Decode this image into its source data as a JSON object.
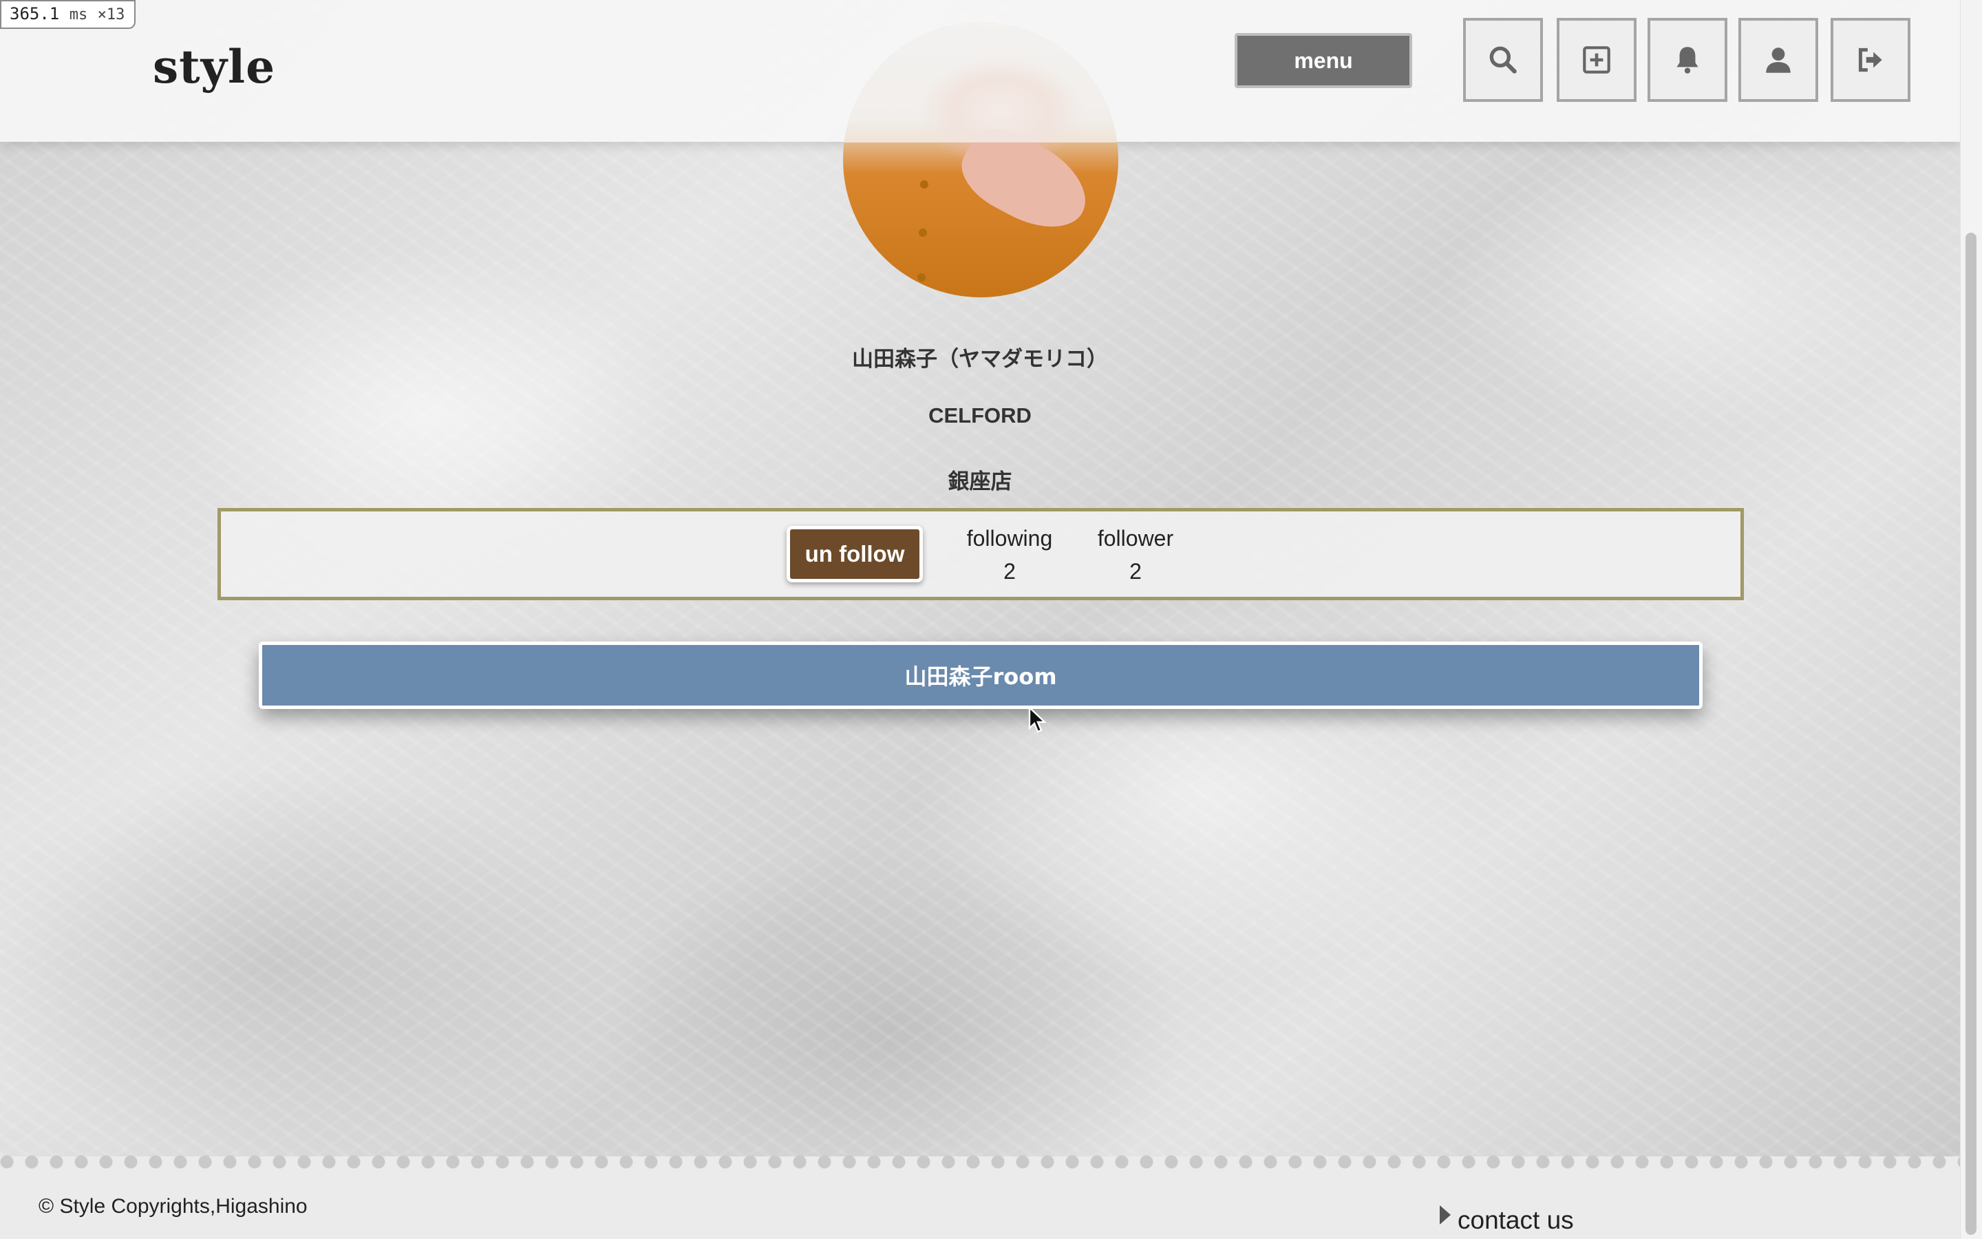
{
  "perf_badge": {
    "value": "365.1",
    "unit": "ms",
    "multiplier": "×13"
  },
  "header": {
    "logo": "style",
    "menu_label": "menu",
    "icons": [
      "search-icon",
      "add-post-icon",
      "bell-icon",
      "user-icon",
      "logout-icon"
    ]
  },
  "profile": {
    "name": "山田森子（ヤマダモリコ）",
    "brand": "CELFORD",
    "store": "銀座店"
  },
  "follow": {
    "button_label": "un follow",
    "following_label": "following",
    "following_count": "2",
    "follower_label": "follower",
    "follower_count": "2"
  },
  "room": {
    "button_label": "山田森子room"
  },
  "footer": {
    "copyright": "© Style Copyrights,Higashino",
    "contact_label": "contact us"
  },
  "colors": {
    "unfollow_bg": "#6d4b2a",
    "room_bg": "#6a8aae",
    "follow_border": "#9f9a67",
    "menu_bg": "#707070"
  }
}
